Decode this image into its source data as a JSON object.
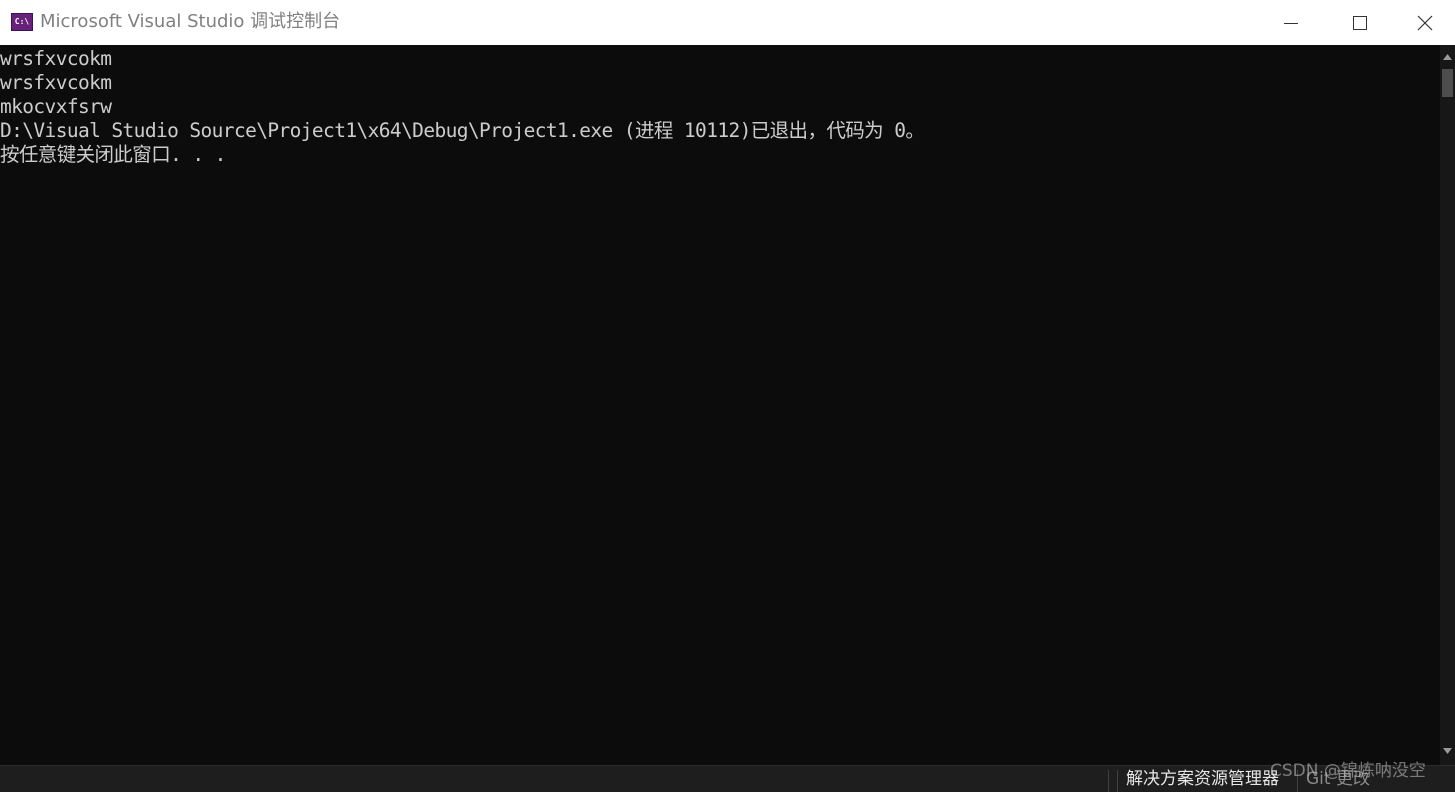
{
  "window": {
    "title": "Microsoft Visual Studio 调试控制台",
    "icon": "vs-debug-console-icon",
    "icon_label": "C:\\"
  },
  "controls": {
    "minimize": "minimize-icon",
    "maximize": "maximize-icon",
    "close": "close-icon"
  },
  "console": {
    "lines": [
      "wrsfxvcokm",
      "wrsfxvcokm",
      "mkocvxfsrw",
      "D:\\Visual Studio Source\\Project1\\x64\\Debug\\Project1.exe (进程 10112)已退出，代码为 0。",
      "按任意键关闭此窗口. . ."
    ],
    "foreground": "#cccccc",
    "background": "#0c0c0c"
  },
  "bottom_bar": {
    "solution_explorer": "解决方案资源管理器",
    "git_changes": "Git 更改"
  },
  "watermark": "CSDN @锦炼呐没空"
}
